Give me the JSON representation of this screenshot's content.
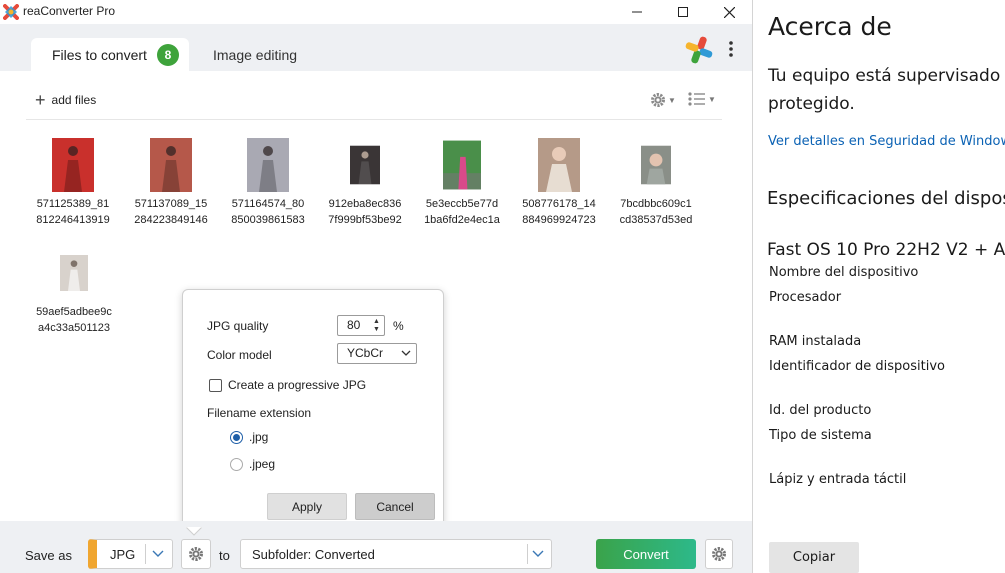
{
  "window": {
    "title": "reaConverter Pro"
  },
  "tabs": {
    "files_label": "Files to convert",
    "files_count": "8",
    "editing_label": "Image editing"
  },
  "toolbar": {
    "add_files_label": "add files"
  },
  "files": [
    {
      "line1": "571125389_81",
      "line2": "812246413919",
      "icon": "photo-thumbnail",
      "color": "#c9302c"
    },
    {
      "line1": "571137089_15",
      "line2": "284223849146",
      "icon": "photo-thumbnail",
      "color": "#b5584a"
    },
    {
      "line1": "571164574_80",
      "line2": "850039861583",
      "icon": "photo-thumbnail",
      "color": "#a9a9b3"
    },
    {
      "line1": "912eba8ec836",
      "line2": "7f999bf53be92",
      "icon": "photo-thumbnail",
      "color": "#3a3536"
    },
    {
      "line1": "5e3eccb5e77d",
      "line2": "1ba6fd2e4ec1a",
      "icon": "photo-thumbnail",
      "color": "#4a8f4a"
    },
    {
      "line1": "508776178_14",
      "line2": "884969924723",
      "icon": "photo-thumbnail",
      "color": "#b59a88"
    },
    {
      "line1": "7bcdbbc609c1",
      "line2": "cd38537d53ed",
      "icon": "photo-thumbnail",
      "color": "#8a8f88"
    },
    {
      "line1": "59aef5adbee9c",
      "line2": "a4c33a501123",
      "icon": "photo-thumbnail",
      "color": "#d8d2cc"
    }
  ],
  "jpg_options": {
    "quality_label": "JPG quality",
    "quality_value": "80",
    "quality_unit": "%",
    "color_model_label": "Color model",
    "color_model_value": "YCbCr",
    "progressive_label": "Create a progressive JPG",
    "progressive_checked": false,
    "extension_heading": "Filename extension",
    "ext_jpg": ".jpg",
    "ext_jpeg": ".jpeg",
    "selected_extension": ".jpg",
    "apply_label": "Apply",
    "cancel_label": "Cancel"
  },
  "bottom": {
    "save_as_label": "Save as",
    "format": "JPG",
    "format_color": "#f0a630",
    "to_label": "to",
    "destination": "Subfolder: Converted",
    "convert_label": "Convert"
  },
  "settings": {
    "title": "Acerca de",
    "status_line1": "Tu equipo está supervisado y",
    "status_line2": "protegido.",
    "security_link": "Ver detalles en Seguridad de Windows",
    "specs_heading": "Especificaciones del dispositivo",
    "os_name": "Fast OS 10 Pro 22H2 V2 + A",
    "rows": [
      "Nombre del dispositivo",
      "Procesador",
      "RAM instalada",
      "Identificador de dispositivo",
      "Id. del producto",
      "Tipo de sistema",
      "Lápiz y entrada táctil"
    ],
    "copy_label": "Copiar"
  }
}
